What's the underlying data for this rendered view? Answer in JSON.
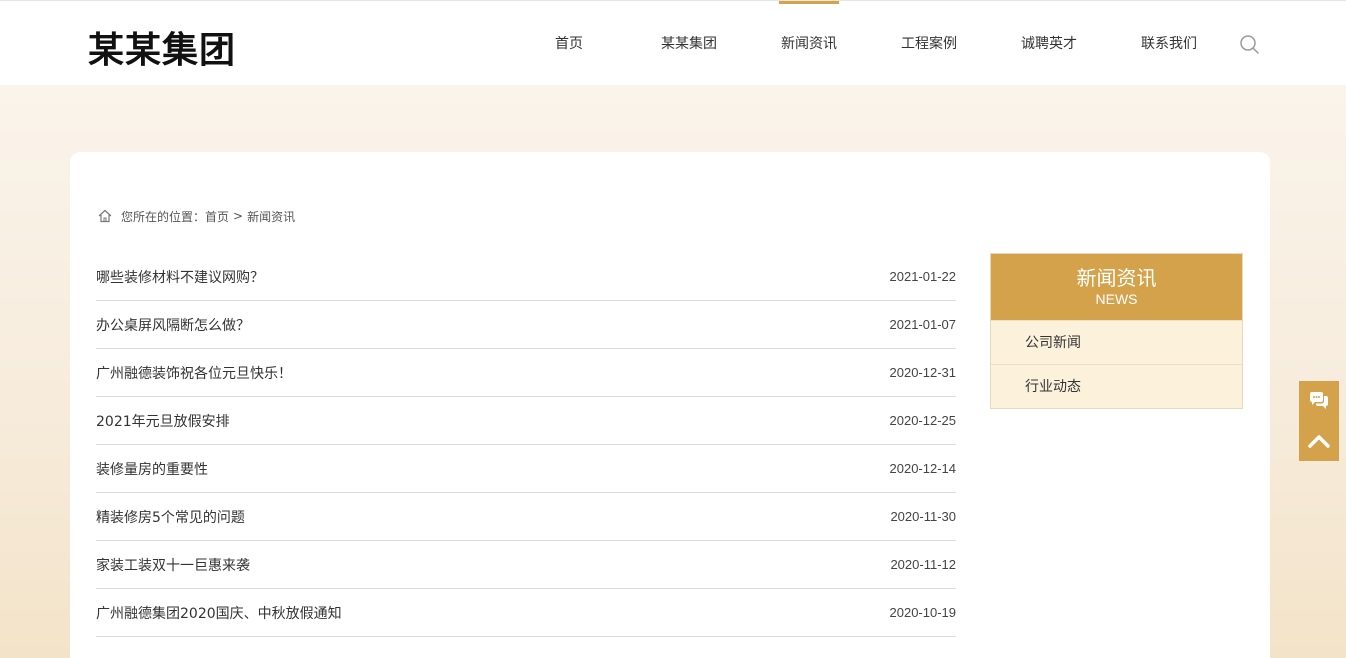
{
  "header": {
    "logo": "某某集团",
    "nav": [
      "首页",
      "某某集团",
      "新闻资讯",
      "工程案例",
      "诚聘英才",
      "联系我们"
    ],
    "active_nav": "新闻资讯",
    "search_icon": "search-icon"
  },
  "breadcrumb": {
    "prefix": "您所在的位置：",
    "home": "首页",
    "separator": ">",
    "current": "新闻资讯"
  },
  "news": [
    {
      "title": "哪些装修材料不建议网购？",
      "date": "2021-01-22"
    },
    {
      "title": "办公桌屏风隔断怎么做？",
      "date": "2021-01-07"
    },
    {
      "title": "广州融德装饰祝各位元旦快乐！",
      "date": "2020-12-31"
    },
    {
      "title": "2021年元旦放假安排",
      "date": "2020-12-25"
    },
    {
      "title": "装修量房的重要性",
      "date": "2020-12-14"
    },
    {
      "title": "精装修房5个常见的问题",
      "date": "2020-11-30"
    },
    {
      "title": "家装工装双十一巨惠来袭",
      "date": "2020-11-12"
    },
    {
      "title": "广州融德集团2020国庆、中秋放假通知",
      "date": "2020-10-19"
    }
  ],
  "sidebar": {
    "title": "新闻资讯",
    "subtitle": "NEWS",
    "items": [
      "公司新闻",
      "行业动态"
    ]
  },
  "float": {
    "chat_icon": "chat-icon",
    "top_icon": "chevron-up-icon"
  },
  "colors": {
    "accent": "#d4a24a",
    "sidebar_item_bg": "#fcf2dc"
  }
}
